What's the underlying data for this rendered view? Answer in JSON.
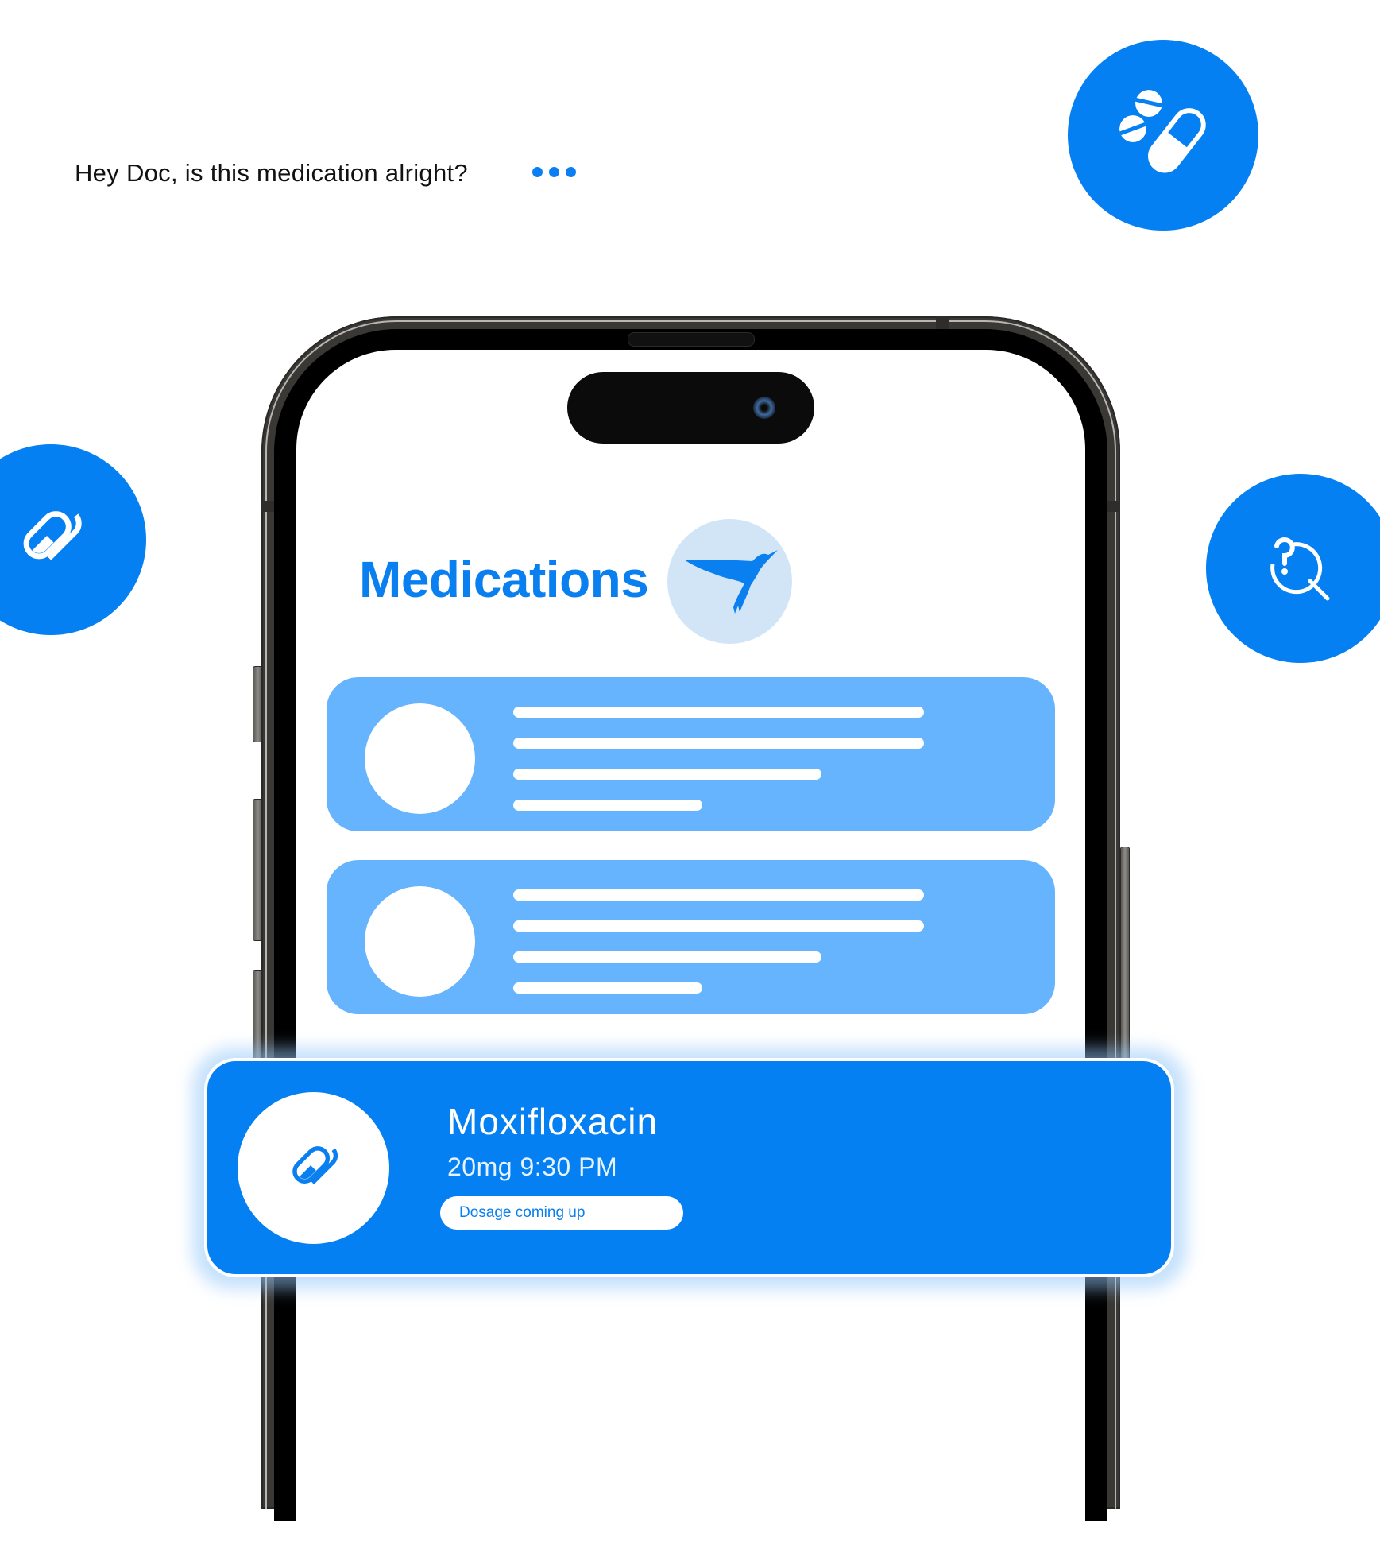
{
  "prompt": {
    "text": "Hey Doc, is this medication alright?",
    "typing_indicator": "typing-dots-icon"
  },
  "floating_icons": [
    {
      "name": "pills-capsule-icon",
      "position": "top-right"
    },
    {
      "name": "capsule-icon",
      "position": "left"
    },
    {
      "name": "question-search-icon",
      "position": "right"
    }
  ],
  "screen": {
    "title": "Medications",
    "avatar_icon": "bird-icon",
    "placeholder_cards": [
      {
        "lines": 4
      },
      {
        "lines": 4
      }
    ]
  },
  "notification": {
    "icon": "capsule-icon",
    "medication_name": "Moxifloxacin",
    "dosage_time": "20mg 9:30 PM",
    "status_badge": "Dosage coming up"
  },
  "colors": {
    "accent": "#0580f2",
    "card_light": "#66b3fe",
    "avatar_bg": "#d1e5f6",
    "text_dark": "#111111"
  }
}
